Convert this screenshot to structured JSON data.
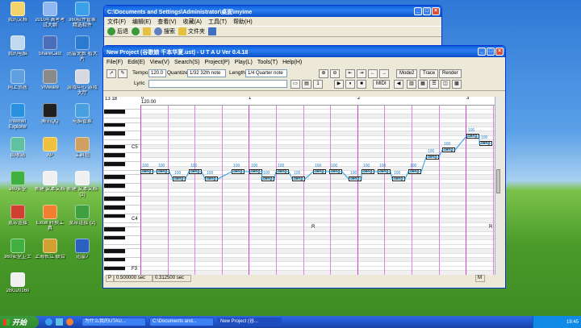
{
  "desktop_icons": [
    {
      "label": "我的文档",
      "color": "#f5d36b"
    },
    {
      "label": "2010年高考考试大纲",
      "color": "#8fb8f0"
    },
    {
      "label": "360软件管家 精选软件",
      "color": "#3aa0e8"
    },
    {
      "label": "我的电脑",
      "color": "#c0d8f0"
    },
    {
      "label": "ShareCast",
      "color": "#4a6fb8"
    },
    {
      "label": "迅雷免费 看大片",
      "color": "#2a7ad0"
    },
    {
      "label": "网上邻居",
      "color": "#60a0e0"
    },
    {
      "label": "VMware",
      "color": "#8a8a8a"
    },
    {
      "label": "游戏中心 游戏大厅",
      "color": "#d8d8e0"
    },
    {
      "label": "Internet Explorer",
      "color": "#2a90e0"
    },
    {
      "label": "腾讯QQ",
      "color": "#202020"
    },
    {
      "label": "电脑管家",
      "color": "#48a0e0"
    },
    {
      "label": "回收站",
      "color": "#60c0a0"
    },
    {
      "label": "AP",
      "color": "#f0c040"
    },
    {
      "label": "工具包",
      "color": "#d0a060"
    },
    {
      "label": "360安全",
      "color": "#40b040"
    },
    {
      "label": "新建 文本文档",
      "color": "#f0f0f0"
    },
    {
      "label": "新建 文本文档 (2)",
      "color": "#f0f0f0"
    },
    {
      "label": "宽带连接",
      "color": "#d04030"
    },
    {
      "label": "Excel 转换工具",
      "color": "#f08030"
    },
    {
      "label": "宽带连接 (2)",
      "color": "#40a040"
    },
    {
      "label": "360安全卫士",
      "color": "#40b040"
    },
    {
      "label": "上海长江 联合",
      "color": "#d0a030"
    },
    {
      "label": "迅雷7",
      "color": "#2a60c0"
    },
    {
      "label": "2BG20160",
      "color": "#f0f0f0"
    }
  ],
  "explorer": {
    "title": "C:\\Documents and Settings\\Administrator\\桌面\\myime",
    "menu": [
      "文件(F)",
      "编辑(E)",
      "查看(V)",
      "收藏(A)",
      "工具(T)",
      "帮助(H)"
    ],
    "toolbar": {
      "back": "后退",
      "search": "搜索",
      "folders": "文件夹"
    }
  },
  "utau": {
    "title": "New Project (谷歌娘 千本华夏.ust) - U T A U  Ver 0.4.18",
    "menu": [
      "File(F)",
      "Edit(E)",
      "View(V)",
      "Search(S)",
      "Project(P)",
      "Play(L)",
      "Tools(T)",
      "Help(H)"
    ],
    "tempo_label": "Tempo",
    "tempo": "120.0",
    "quantize_label": "Quantize",
    "quantize": "1/32 32th note",
    "length_label": "Length",
    "length": "1/4 Quarter note",
    "lyric_label": "Lyric",
    "buttons": {
      "midi": "MIDI",
      "mode2": "Mode2",
      "trace": "Trace",
      "render": "Render"
    },
    "ruler": {
      "tempo": "120.00",
      "markers": [
        "0",
        "1",
        "2",
        "3"
      ],
      "track": "13 18"
    },
    "keys": {
      "c5": "C5",
      "c4": "C4",
      "f3": "F3"
    },
    "rest": "R",
    "note_lyric": "deng",
    "note_velocity": "100",
    "status": {
      "a": "P",
      "b": "0.500000 sec",
      "c": "0.312500 sec",
      "d": "M"
    }
  },
  "taskbar": {
    "start": "开始",
    "tasks": [
      "为什么我的UTAU...",
      "C:\\Documents and...",
      "New Project (谷..."
    ],
    "clock": "19:45"
  }
}
